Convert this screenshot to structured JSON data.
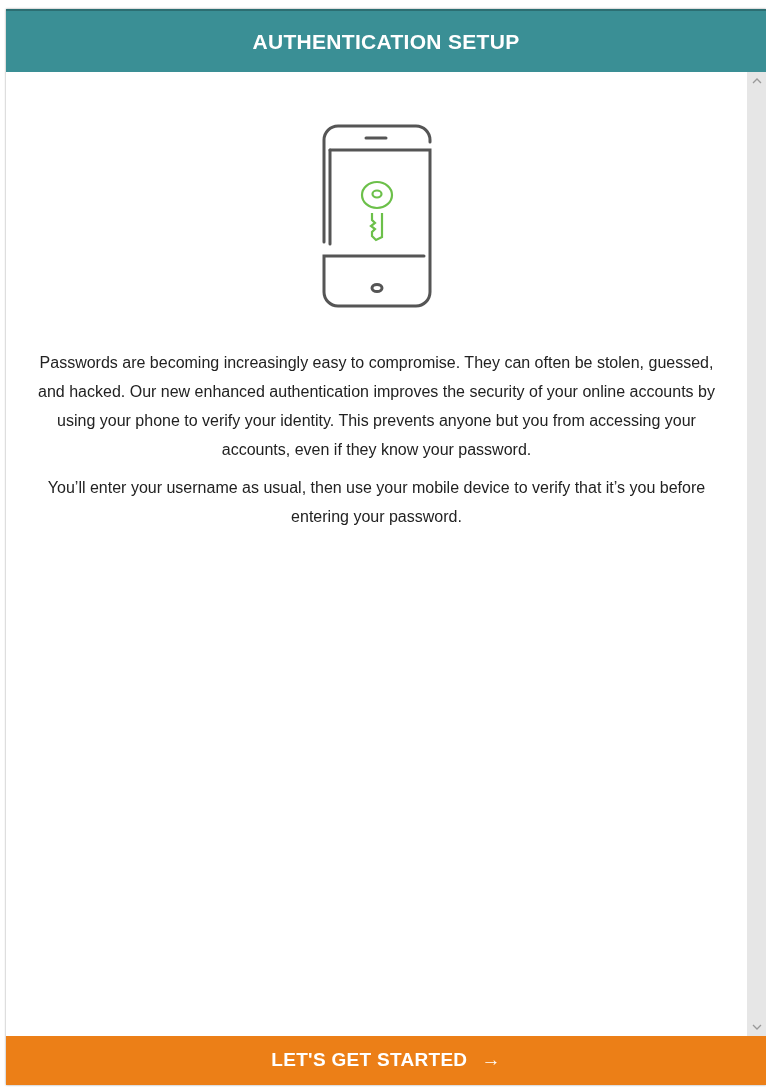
{
  "header": {
    "title": "AUTHENTICATION SETUP"
  },
  "paragraphs": [
    "Passwords are becoming increasingly easy to compromise. They can often be stolen, guessed, and hacked. Our new enhanced authentication improves the security of your online accounts by using your phone to verify your identity. This prevents anyone but you from accessing your accounts, even if they know your password.",
    "You’ll enter your username as usual, then use your mobile device to verify that it’s you before entering your password."
  ],
  "button": {
    "label": "LET'S GET STARTED",
    "arrow": "→"
  }
}
